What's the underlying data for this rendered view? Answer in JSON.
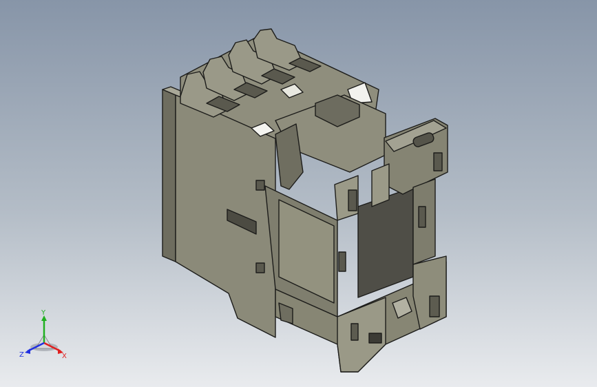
{
  "viewport": {
    "background_top": "#8795a8",
    "background_bottom": "#e9ebee",
    "model_color": "#8c8b7a",
    "edge_color": "#1c1c1a"
  },
  "triad": {
    "x_label": "X",
    "y_label": "Y",
    "z_label": "Z",
    "x_color": "#e02020",
    "y_color": "#20b020",
    "z_color": "#2030e0"
  }
}
